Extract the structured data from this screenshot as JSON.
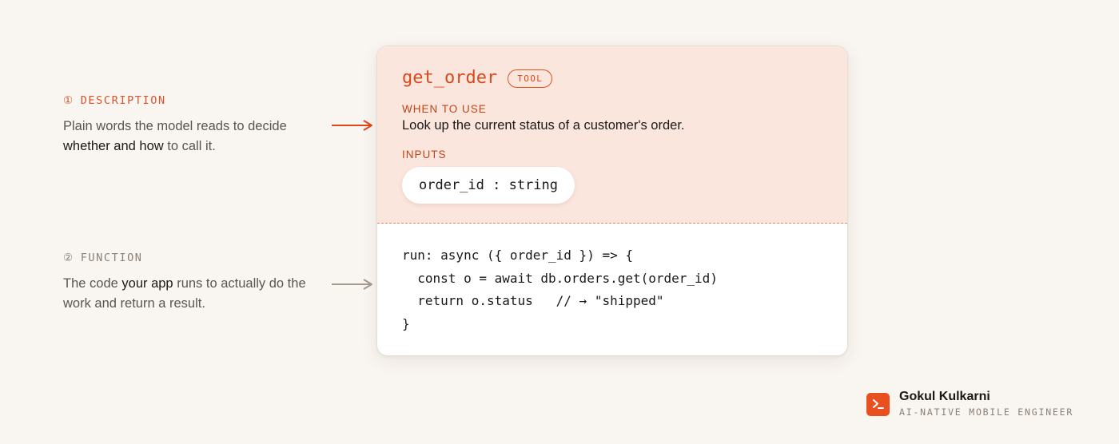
{
  "annotations": {
    "description": {
      "number": "①",
      "label": "DESCRIPTION",
      "text_1": "Plain words the model reads to decide ",
      "emphasis": "whether and how",
      "text_2": " to call it."
    },
    "function": {
      "number": "②",
      "label": "FUNCTION",
      "text_1": "The code ",
      "emphasis": "your app",
      "text_2": " runs to actually do the work and return a result."
    }
  },
  "card": {
    "tool_name": "get_order",
    "badge": "TOOL",
    "when_label": "WHEN TO USE",
    "when_text": "Look up the current status of a customer's order.",
    "inputs_label": "INPUTS",
    "input": "order_id : string",
    "code_lines": [
      "run: async ({ order_id }) => {",
      "  const o = await db.orders.get(order_id)",
      "  return o.status   // → \"shipped\"",
      "}"
    ]
  },
  "author": {
    "name": "Gokul Kulkarni",
    "role": "AI-NATIVE MOBILE ENGINEER"
  },
  "colors": {
    "accent": "#d8491e",
    "card_top_bg": "#fbe6de",
    "page_bg": "#f9f5f0",
    "muted_arrow": "#a39a90"
  }
}
